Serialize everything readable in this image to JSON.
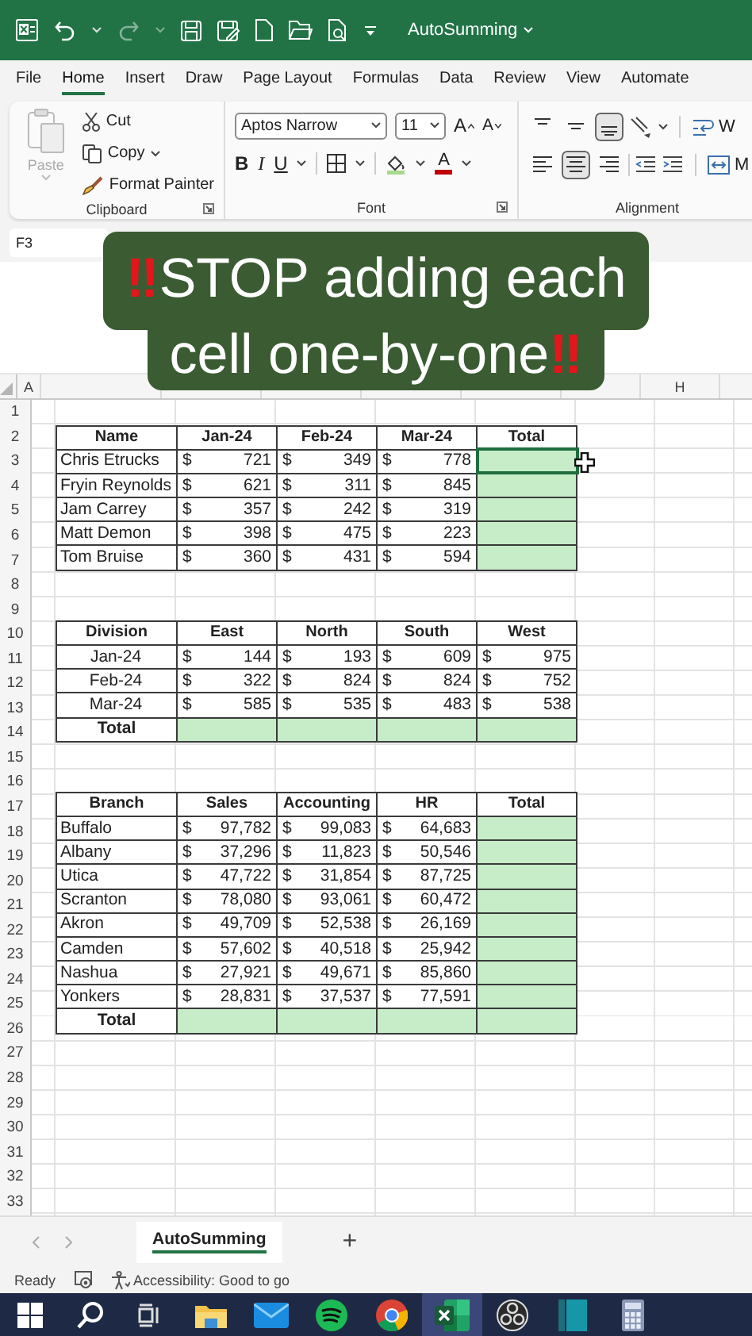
{
  "title_bar": {
    "document_title": "AutoSumming"
  },
  "ribbon_tabs": [
    {
      "label": "File",
      "selected": false
    },
    {
      "label": "Home",
      "selected": true
    },
    {
      "label": "Insert",
      "selected": false
    },
    {
      "label": "Draw",
      "selected": false
    },
    {
      "label": "Page Layout",
      "selected": false
    },
    {
      "label": "Formulas",
      "selected": false
    },
    {
      "label": "Data",
      "selected": false
    },
    {
      "label": "Review",
      "selected": false
    },
    {
      "label": "View",
      "selected": false
    },
    {
      "label": "Automate",
      "selected": false
    }
  ],
  "clipboard": {
    "paste": "Paste",
    "paste_disabled": true,
    "cut": "Cut",
    "copy": "Copy",
    "format_painter": "Format Painter",
    "group_label": "Clipboard"
  },
  "font": {
    "family": "Aptos Narrow",
    "size": "11",
    "grow": "A",
    "shrink": "A",
    "bold": "B",
    "italic": "I",
    "underline": "U",
    "color_letter": "A",
    "group_label": "Font"
  },
  "alignment": {
    "vertical_buttons": [
      {
        "selected": false
      },
      {
        "selected": false
      },
      {
        "selected": true
      }
    ],
    "horizontal_buttons": [
      {
        "selected": false
      },
      {
        "selected": true
      },
      {
        "selected": false
      }
    ],
    "wrap_text": "W",
    "merge": "M",
    "group_label": "Alignment"
  },
  "name_box": "F3",
  "banner": {
    "lines": [
      {
        "lead": "‼",
        "text": "STOP adding each"
      },
      {
        "text": "cell one-by-one",
        "trail": "‼"
      }
    ]
  },
  "column_headers": [
    "A",
    "H"
  ],
  "row_numbers": [
    "1",
    "2",
    "3",
    "4",
    "5",
    "6",
    "7",
    "8",
    "9",
    "10",
    "11",
    "12",
    "13",
    "14",
    "15",
    "16",
    "17",
    "18",
    "19",
    "20",
    "21",
    "22",
    "23",
    "24",
    "25",
    "26",
    "27",
    "28",
    "29",
    "30",
    "31",
    "32",
    "33"
  ],
  "tables": [
    {
      "labels_centered": false,
      "columns": [
        "Name",
        "Jan-24",
        "Feb-24",
        "Mar-24",
        "Total"
      ],
      "rows": [
        {
          "kind": "data",
          "cells": [
            "Chris Etrucks",
            "$ 721",
            "$ 349",
            "$ 778"
          ],
          "blank_highlighted": true,
          "selected": true
        },
        {
          "kind": "data",
          "cells": [
            "Fryin Reynolds",
            "$ 621",
            "$ 311",
            "$ 845"
          ],
          "blank_highlighted": true,
          "selected": false
        },
        {
          "kind": "data",
          "cells": [
            "Jam Carrey",
            "$ 357",
            "$ 242",
            "$ 319"
          ],
          "blank_highlighted": true,
          "selected": false
        },
        {
          "kind": "data",
          "cells": [
            "Matt Demon",
            "$ 398",
            "$ 475",
            "$ 223"
          ],
          "blank_highlighted": true,
          "selected": false
        },
        {
          "kind": "data",
          "cells": [
            "Tom Bruise",
            "$ 360",
            "$ 431",
            "$ 594"
          ],
          "blank_highlighted": true,
          "selected": false
        }
      ]
    },
    {
      "labels_centered": true,
      "columns": [
        "Division",
        "East",
        "North",
        "South",
        "West"
      ],
      "rows": [
        {
          "kind": "data",
          "cells": [
            "Jan-24",
            "$ 144",
            "$ 193",
            "$ 609",
            "$ 975"
          ]
        },
        {
          "kind": "data",
          "cells": [
            "Feb-24",
            "$ 322",
            "$ 824",
            "$ 824",
            "$ 752"
          ]
        },
        {
          "kind": "data",
          "cells": [
            "Mar-24",
            "$ 585",
            "$ 535",
            "$ 483",
            "$ 538"
          ]
        },
        {
          "kind": "total",
          "cells": [
            "Total"
          ],
          "blank_highlighted": true
        }
      ]
    },
    {
      "labels_centered": false,
      "columns": [
        "Branch",
        "Sales",
        "Accounting",
        "HR",
        "Total"
      ],
      "rows": [
        {
          "kind": "data",
          "cells": [
            "Buffalo",
            "$ 97,782",
            "$ 99,083",
            "$ 64,683"
          ],
          "blank_highlighted": true
        },
        {
          "kind": "data",
          "cells": [
            "Albany",
            "$ 37,296",
            "$ 11,823",
            "$ 50,546"
          ],
          "blank_highlighted": true
        },
        {
          "kind": "data",
          "cells": [
            "Utica",
            "$ 47,722",
            "$ 31,854",
            "$ 87,725"
          ],
          "blank_highlighted": true
        },
        {
          "kind": "data",
          "cells": [
            "Scranton",
            "$ 78,080",
            "$ 93,061",
            "$ 60,472"
          ],
          "blank_highlighted": true
        },
        {
          "kind": "data",
          "cells": [
            "Akron",
            "$ 49,709",
            "$ 52,538",
            "$ 26,169"
          ],
          "blank_highlighted": true
        },
        {
          "kind": "data",
          "cells": [
            "Camden",
            "$ 57,602",
            "$ 40,518",
            "$ 25,942"
          ],
          "blank_highlighted": true
        },
        {
          "kind": "data",
          "cells": [
            "Nashua",
            "$ 27,921",
            "$ 49,671",
            "$ 85,860"
          ],
          "blank_highlighted": true
        },
        {
          "kind": "data",
          "cells": [
            "Yonkers",
            "$ 28,831",
            "$ 37,537",
            "$ 77,591"
          ],
          "blank_highlighted": true
        },
        {
          "kind": "total",
          "cells": [
            "Total"
          ],
          "blank_highlighted": true
        }
      ]
    }
  ],
  "sheet_tabs": [
    {
      "label": "AutoSumming",
      "selected": true
    }
  ],
  "add_sheet": "+",
  "status_bar": {
    "mode": "Ready",
    "accessibility": "Accessibility: Good to go"
  },
  "taskbar": [
    {
      "kind": "start",
      "active": false
    },
    {
      "kind": "search",
      "active": false
    },
    {
      "kind": "task-view",
      "active": false
    },
    {
      "kind": "folder",
      "active": false
    },
    {
      "kind": "mail",
      "active": false
    },
    {
      "kind": "waves",
      "active": false
    },
    {
      "kind": "browser",
      "active": false
    },
    {
      "kind": "spreadsheet",
      "active": true
    },
    {
      "kind": "aperture",
      "active": false
    },
    {
      "kind": "notebook",
      "active": false
    },
    {
      "kind": "calculator",
      "active": false
    }
  ]
}
